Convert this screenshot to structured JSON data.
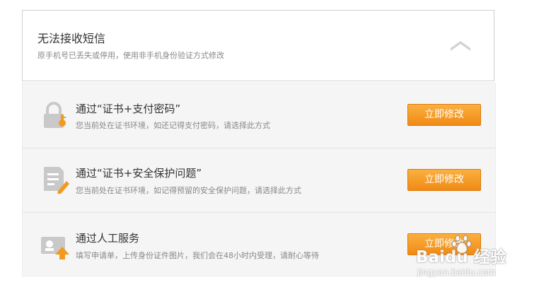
{
  "header": {
    "title": "无法接收短信",
    "subtitle": "原手机号已丢失或停用，使用非手机身份验证方式修改"
  },
  "options": [
    {
      "title": "通过“证书+支付密码”",
      "description": "您当前处在证书环境，如还记得支付密码，请选择此方式",
      "button_label": "立即修改",
      "icon": "lock-certificate-icon"
    },
    {
      "title": "通过“证书+安全保护问题”",
      "description": "您当前处在证书环境，如记得预留的安全保护问题，请选择此方式",
      "button_label": "立即修改",
      "icon": "document-pencil-icon"
    },
    {
      "title": "通过人工服务",
      "description": "填写申请单，上传身份证件图片，我们会在48小时内受理，请耐心等待",
      "button_label": "立即修改",
      "icon": "id-card-upload-icon"
    }
  ],
  "watermark": {
    "brand": "Baidu 经验",
    "url": "jingyan.baidu.com"
  },
  "colors": {
    "button_top": "#fbb040",
    "button_bottom": "#f08a14",
    "icon_gray": "#c9c9c9",
    "icon_accent": "#f39a1e"
  }
}
